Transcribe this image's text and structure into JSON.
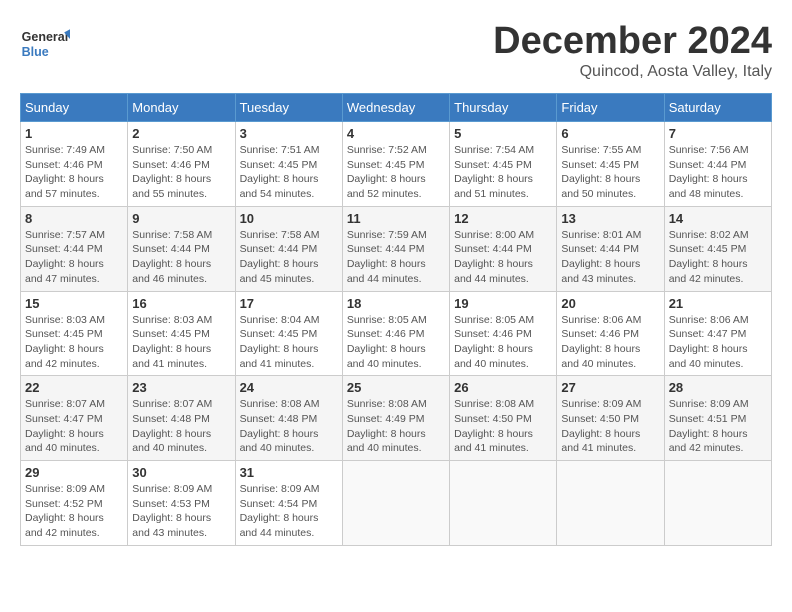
{
  "logo": {
    "text_general": "General",
    "text_blue": "Blue"
  },
  "title": {
    "month": "December 2024",
    "location": "Quincod, Aosta Valley, Italy"
  },
  "weekdays": [
    "Sunday",
    "Monday",
    "Tuesday",
    "Wednesday",
    "Thursday",
    "Friday",
    "Saturday"
  ],
  "weeks": [
    [
      {
        "day": "1",
        "sunrise": "7:49 AM",
        "sunset": "4:46 PM",
        "daylight": "8 hours and 57 minutes."
      },
      {
        "day": "2",
        "sunrise": "7:50 AM",
        "sunset": "4:46 PM",
        "daylight": "8 hours and 55 minutes."
      },
      {
        "day": "3",
        "sunrise": "7:51 AM",
        "sunset": "4:45 PM",
        "daylight": "8 hours and 54 minutes."
      },
      {
        "day": "4",
        "sunrise": "7:52 AM",
        "sunset": "4:45 PM",
        "daylight": "8 hours and 52 minutes."
      },
      {
        "day": "5",
        "sunrise": "7:54 AM",
        "sunset": "4:45 PM",
        "daylight": "8 hours and 51 minutes."
      },
      {
        "day": "6",
        "sunrise": "7:55 AM",
        "sunset": "4:45 PM",
        "daylight": "8 hours and 50 minutes."
      },
      {
        "day": "7",
        "sunrise": "7:56 AM",
        "sunset": "4:44 PM",
        "daylight": "8 hours and 48 minutes."
      }
    ],
    [
      {
        "day": "8",
        "sunrise": "7:57 AM",
        "sunset": "4:44 PM",
        "daylight": "8 hours and 47 minutes."
      },
      {
        "day": "9",
        "sunrise": "7:58 AM",
        "sunset": "4:44 PM",
        "daylight": "8 hours and 46 minutes."
      },
      {
        "day": "10",
        "sunrise": "7:58 AM",
        "sunset": "4:44 PM",
        "daylight": "8 hours and 45 minutes."
      },
      {
        "day": "11",
        "sunrise": "7:59 AM",
        "sunset": "4:44 PM",
        "daylight": "8 hours and 44 minutes."
      },
      {
        "day": "12",
        "sunrise": "8:00 AM",
        "sunset": "4:44 PM",
        "daylight": "8 hours and 44 minutes."
      },
      {
        "day": "13",
        "sunrise": "8:01 AM",
        "sunset": "4:44 PM",
        "daylight": "8 hours and 43 minutes."
      },
      {
        "day": "14",
        "sunrise": "8:02 AM",
        "sunset": "4:45 PM",
        "daylight": "8 hours and 42 minutes."
      }
    ],
    [
      {
        "day": "15",
        "sunrise": "8:03 AM",
        "sunset": "4:45 PM",
        "daylight": "8 hours and 42 minutes."
      },
      {
        "day": "16",
        "sunrise": "8:03 AM",
        "sunset": "4:45 PM",
        "daylight": "8 hours and 41 minutes."
      },
      {
        "day": "17",
        "sunrise": "8:04 AM",
        "sunset": "4:45 PM",
        "daylight": "8 hours and 41 minutes."
      },
      {
        "day": "18",
        "sunrise": "8:05 AM",
        "sunset": "4:46 PM",
        "daylight": "8 hours and 40 minutes."
      },
      {
        "day": "19",
        "sunrise": "8:05 AM",
        "sunset": "4:46 PM",
        "daylight": "8 hours and 40 minutes."
      },
      {
        "day": "20",
        "sunrise": "8:06 AM",
        "sunset": "4:46 PM",
        "daylight": "8 hours and 40 minutes."
      },
      {
        "day": "21",
        "sunrise": "8:06 AM",
        "sunset": "4:47 PM",
        "daylight": "8 hours and 40 minutes."
      }
    ],
    [
      {
        "day": "22",
        "sunrise": "8:07 AM",
        "sunset": "4:47 PM",
        "daylight": "8 hours and 40 minutes."
      },
      {
        "day": "23",
        "sunrise": "8:07 AM",
        "sunset": "4:48 PM",
        "daylight": "8 hours and 40 minutes."
      },
      {
        "day": "24",
        "sunrise": "8:08 AM",
        "sunset": "4:48 PM",
        "daylight": "8 hours and 40 minutes."
      },
      {
        "day": "25",
        "sunrise": "8:08 AM",
        "sunset": "4:49 PM",
        "daylight": "8 hours and 40 minutes."
      },
      {
        "day": "26",
        "sunrise": "8:08 AM",
        "sunset": "4:50 PM",
        "daylight": "8 hours and 41 minutes."
      },
      {
        "day": "27",
        "sunrise": "8:09 AM",
        "sunset": "4:50 PM",
        "daylight": "8 hours and 41 minutes."
      },
      {
        "day": "28",
        "sunrise": "8:09 AM",
        "sunset": "4:51 PM",
        "daylight": "8 hours and 42 minutes."
      }
    ],
    [
      {
        "day": "29",
        "sunrise": "8:09 AM",
        "sunset": "4:52 PM",
        "daylight": "8 hours and 42 minutes."
      },
      {
        "day": "30",
        "sunrise": "8:09 AM",
        "sunset": "4:53 PM",
        "daylight": "8 hours and 43 minutes."
      },
      {
        "day": "31",
        "sunrise": "8:09 AM",
        "sunset": "4:54 PM",
        "daylight": "8 hours and 44 minutes."
      },
      null,
      null,
      null,
      null
    ]
  ]
}
